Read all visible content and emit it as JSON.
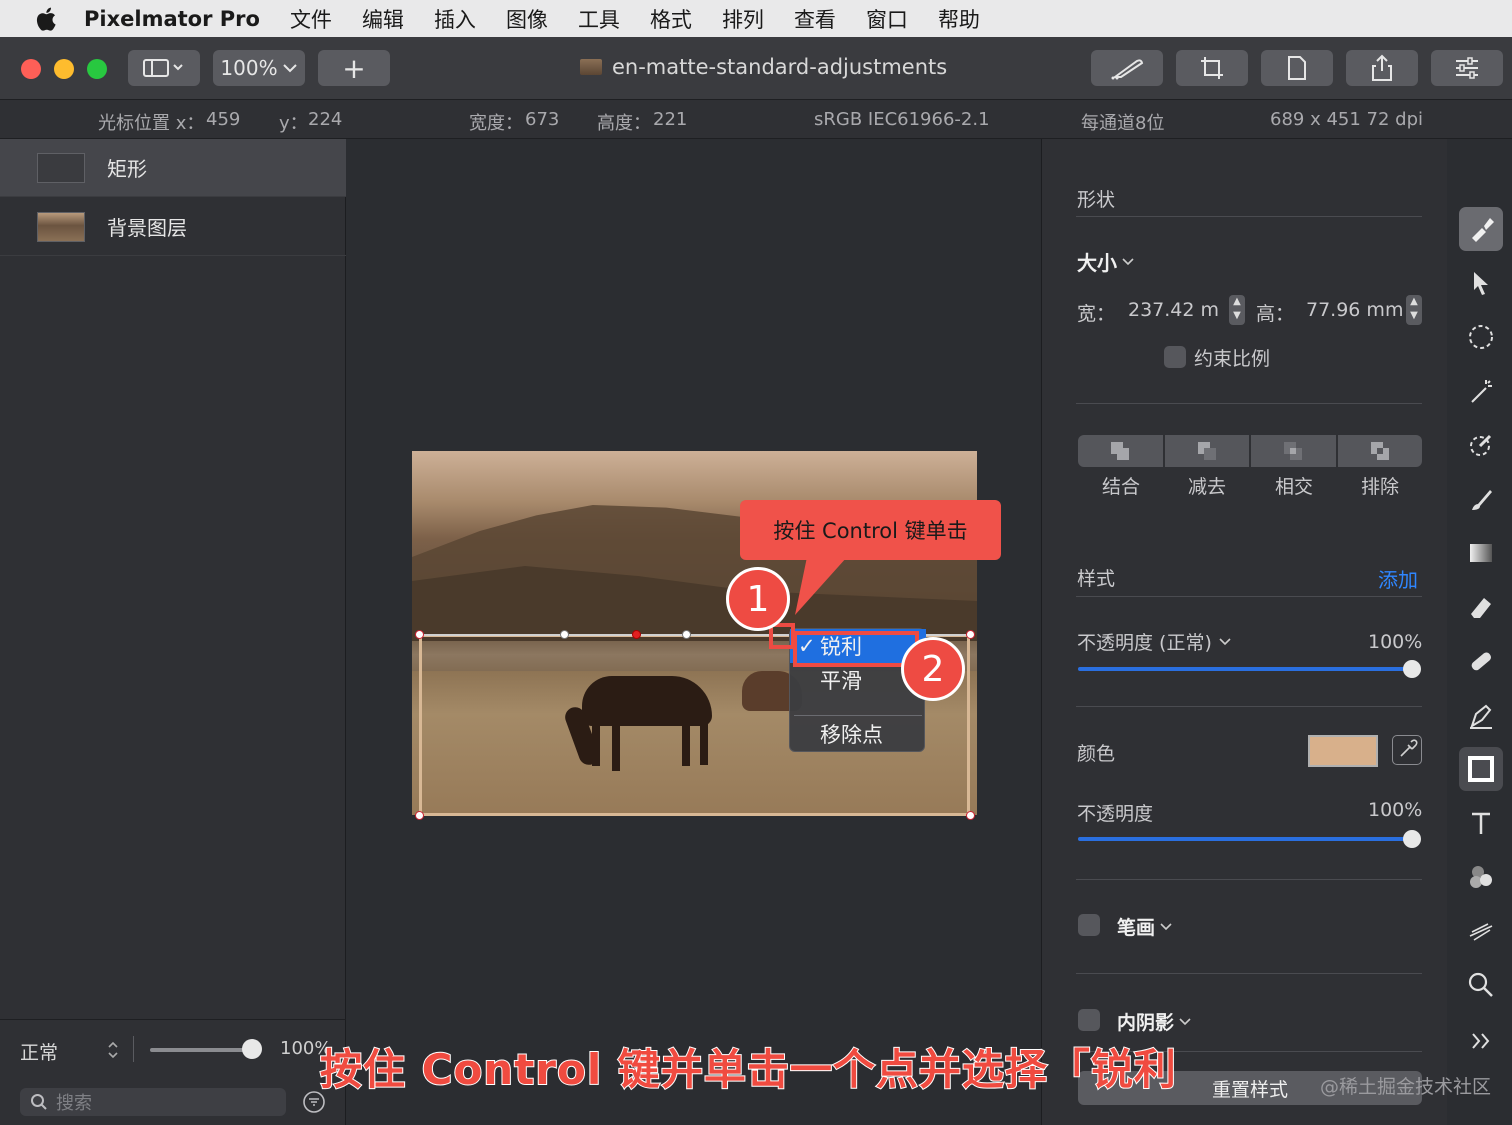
{
  "menubar": {
    "app_name": "Pixelmator Pro",
    "items": [
      "文件",
      "编辑",
      "插入",
      "图像",
      "工具",
      "格式",
      "排列",
      "查看",
      "窗口",
      "帮助"
    ]
  },
  "toolbar": {
    "zoom": "100%",
    "add_label": "+",
    "document_title": "en-matte-standard-adjustments"
  },
  "infobar": {
    "cursor_x_label": "光标位置 x：",
    "cursor_x": "459",
    "cursor_y_label": "y：",
    "cursor_y": "224",
    "width_label": "宽度：",
    "width": "673",
    "height_label": "高度：",
    "height": "221",
    "color_profile": "sRGB IEC61966-2.1",
    "bit_depth": "每通道8位",
    "image_size": "689 x 451 72 dpi"
  },
  "layers": {
    "items": [
      {
        "name": "矩形"
      },
      {
        "name": "背景图层"
      }
    ],
    "blend_mode": "正常",
    "opacity": "100%",
    "search_placeholder": "搜索"
  },
  "canvas": {
    "callout_text": "按住 Control 键单击",
    "badge_1": "1",
    "badge_2": "2",
    "context_menu": {
      "check": "✓",
      "items": [
        "锐利",
        "平滑",
        "移除点"
      ]
    }
  },
  "inspector": {
    "section_shape": "形状",
    "size_label": "大小",
    "width_label": "宽：",
    "width_value": "237.42 mı",
    "height_label": "高：",
    "height_value": "77.96 mm",
    "constrain_label": "约束比例",
    "boolean_ops": [
      "结合",
      "减去",
      "相交",
      "排除"
    ],
    "section_style": "样式",
    "add_label": "添加",
    "opacity_normal_label": "不透明度 (正常)",
    "opacity_normal_value": "100%",
    "opacity_normal_level": 1.0,
    "color_label": "颜色",
    "fill_color": "#d8b08b",
    "opacity_label": "不透明度",
    "opacity_value": "100%",
    "opacity_level": 1.0,
    "stroke_label": "笔画",
    "inner_shadow_label": "内阴影",
    "reset_label": "重置样式"
  },
  "caption": "按住 Control 键并单击一个点并选择「锐利",
  "watermark": "@稀土掘金技术社区"
}
